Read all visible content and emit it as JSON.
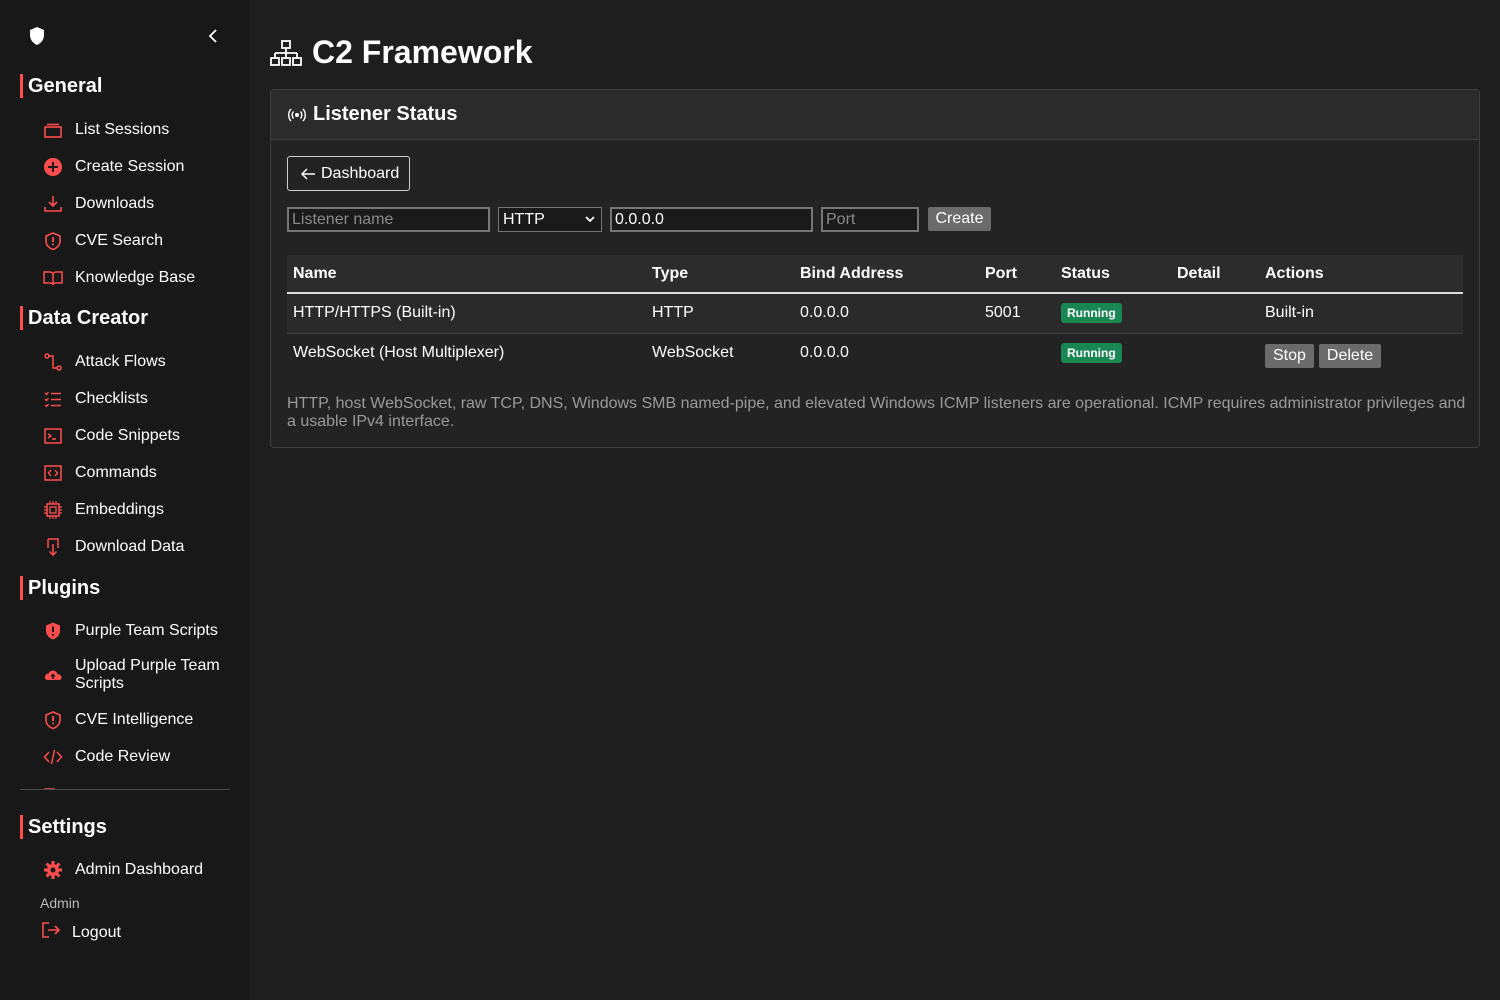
{
  "sidebar": {
    "sections": {
      "general": "General",
      "data_creator": "Data Creator",
      "plugins": "Plugins",
      "settings": "Settings"
    },
    "general_items": [
      "List Sessions",
      "Create Session",
      "Downloads",
      "CVE Search",
      "Knowledge Base"
    ],
    "data_creator_items": [
      "Attack Flows",
      "Checklists",
      "Code Snippets",
      "Commands",
      "Embeddings",
      "Download Data"
    ],
    "plugins_items": [
      "Purple Team Scripts",
      "Upload Purple Team Scripts",
      "CVE Intelligence",
      "Code Review"
    ],
    "settings_items": [
      "Admin Dashboard"
    ],
    "admin_label": "Admin",
    "logout_label": "Logout"
  },
  "page": {
    "title": "C2 Framework"
  },
  "card": {
    "title": "Listener Status",
    "back_label": "Dashboard",
    "form": {
      "name_placeholder": "Listener name",
      "type_value": "HTTP",
      "bind_value": "0.0.0.0",
      "port_placeholder": "Port",
      "create_label": "Create"
    },
    "table": {
      "headers": [
        "Name",
        "Type",
        "Bind Address",
        "Port",
        "Status",
        "Detail",
        "Actions"
      ],
      "rows": [
        {
          "name": "HTTP/HTTPS (Built-in)",
          "type": "HTTP",
          "bind": "0.0.0.0",
          "port": "5001",
          "status": "Running",
          "detail": "",
          "action_text": "Built-in"
        },
        {
          "name": "WebSocket (Host Multiplexer)",
          "type": "WebSocket",
          "bind": "0.0.0.0",
          "port": "",
          "status": "Running",
          "detail": "",
          "stop_label": "Stop",
          "delete_label": "Delete"
        }
      ]
    },
    "note": "HTTP, host WebSocket, raw TCP, DNS, Windows SMB named-pipe, and elevated Windows ICMP listeners are operational. ICMP requires administrator privileges and a usable IPv4 interface."
  },
  "colors": {
    "accent": "#ff4d4d",
    "running_badge": "#198754",
    "background": "#1e1e1e",
    "sidebar": "#181818"
  }
}
